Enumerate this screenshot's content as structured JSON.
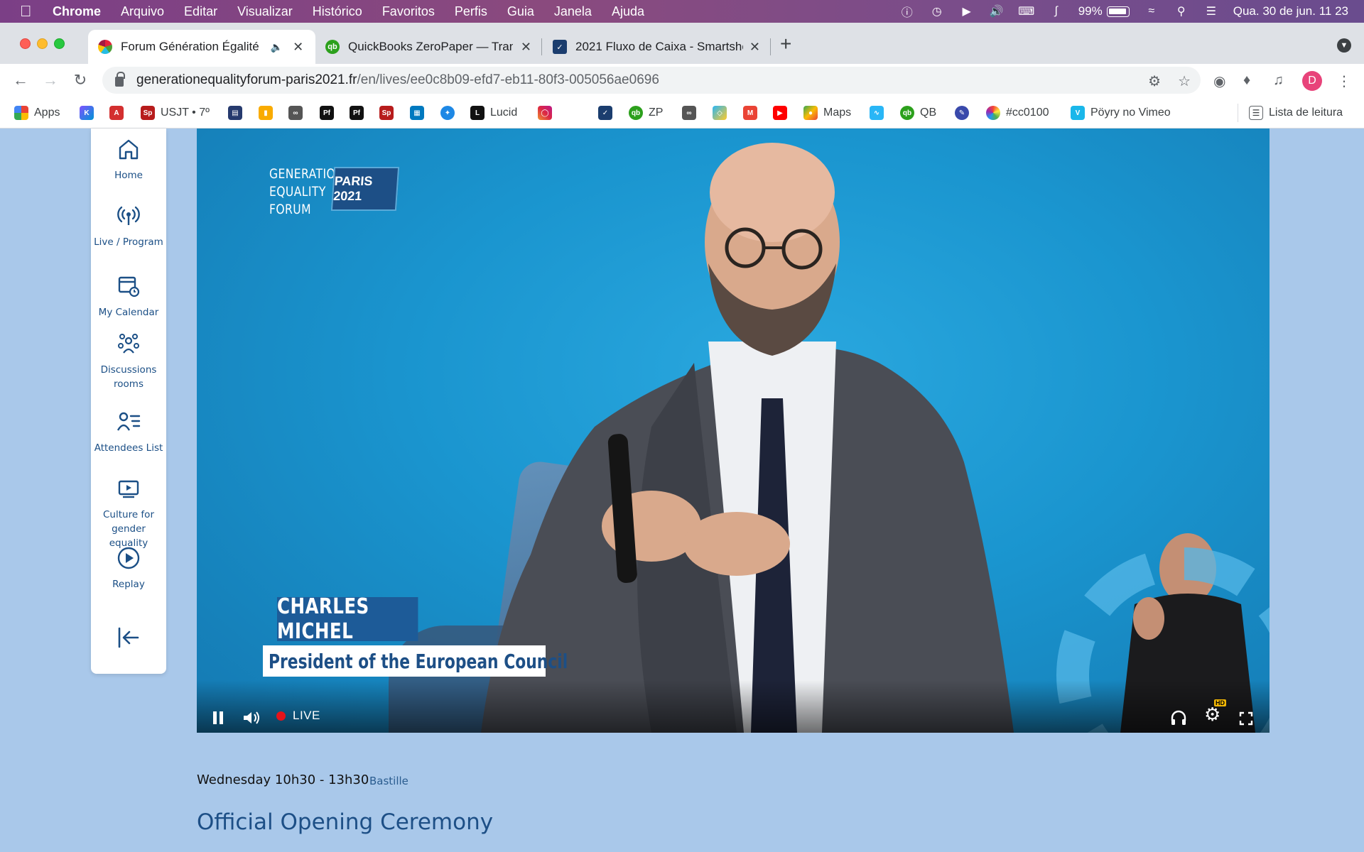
{
  "menubar": {
    "app": "Chrome",
    "items": [
      "Arquivo",
      "Editar",
      "Visualizar",
      "Histórico",
      "Favoritos",
      "Perfis",
      "Guia",
      "Janela",
      "Ajuda"
    ],
    "battery": "99%",
    "datetime": "Qua. 30 de jun.  11 23"
  },
  "tabs": [
    {
      "title": "Forum Génération Égalité",
      "favicon": "un-women-favicon",
      "active": true
    },
    {
      "title": "QuickBooks ZeroPaper — Trans",
      "favicon": "quickbooks-favicon",
      "active": false
    },
    {
      "title": "2021 Fluxo de Caixa - Smartshe",
      "favicon": "smartsheet-favicon",
      "active": false
    }
  ],
  "omnibox": {
    "domain": "generationequalityforum-paris2021.fr",
    "path": "/en/lives/ee0c8b09-efd7-eb11-80f3-005056ae0696"
  },
  "profile": {
    "initial": "D",
    "color": "#e8437a"
  },
  "bookmarks": [
    {
      "label": "Apps",
      "icon": "apps-grid-icon"
    },
    {
      "label": "",
      "icon": "kotlin-icon"
    },
    {
      "label": "",
      "icon": "pdf-icon"
    },
    {
      "label": "USJT • 7º",
      "icon": "sp-icon"
    },
    {
      "label": "",
      "icon": "book-icon"
    },
    {
      "label": "",
      "icon": "analytics-icon"
    },
    {
      "label": "",
      "icon": "infinity-icon"
    },
    {
      "label": "",
      "icon": "pf-icon"
    },
    {
      "label": "",
      "icon": "pf-icon"
    },
    {
      "label": "",
      "icon": "sp-icon"
    },
    {
      "label": "",
      "icon": "trello-icon"
    },
    {
      "label": "",
      "icon": "bug-icon"
    },
    {
      "label": "Lucid",
      "icon": "lucid-icon"
    },
    {
      "label": "",
      "icon": "instagram-icon"
    },
    {
      "label": "",
      "icon": "smartsheet-icon"
    },
    {
      "label": "ZP",
      "icon": "quickbooks-icon"
    },
    {
      "label": "",
      "icon": "infinity-icon"
    },
    {
      "label": "",
      "icon": "diamond-icon"
    },
    {
      "label": "",
      "icon": "gmail-icon"
    },
    {
      "label": "",
      "icon": "youtube-icon"
    },
    {
      "label": "Maps",
      "icon": "maps-icon"
    },
    {
      "label": "",
      "icon": "wave-icon"
    },
    {
      "label": "QB",
      "icon": "quickbooks-icon"
    },
    {
      "label": "",
      "icon": "pen-icon"
    },
    {
      "label": "#cc0100",
      "icon": "color-wheel-icon"
    },
    {
      "label": "Pöyry no Vimeo",
      "icon": "vimeo-icon"
    },
    {
      "label": "Lista de leitura",
      "icon": "reading-list-icon"
    }
  ],
  "sidebar": {
    "items": [
      {
        "label": "Home",
        "icon": "home-icon"
      },
      {
        "label": "Live / Program",
        "icon": "broadcast-icon"
      },
      {
        "label": "My Calendar",
        "icon": "calendar-clock-icon"
      },
      {
        "label": "Discussions rooms",
        "icon": "discussion-group-icon"
      },
      {
        "label": "Attendees List",
        "icon": "attendees-list-icon"
      },
      {
        "label": "Culture for gender equality",
        "icon": "video-play-icon"
      },
      {
        "label": "Replay",
        "icon": "replay-icon"
      },
      {
        "label": "",
        "icon": "logout-icon"
      }
    ]
  },
  "video": {
    "logo_lines": [
      "GENERATION",
      "EQUALITY",
      "FORUM"
    ],
    "logo_badge": "PARIS 2021",
    "speaker_name": "CHARLES MICHEL",
    "speaker_title": "President of the European Council",
    "live_label": "LIVE",
    "hd_badge": "HD",
    "state": "playing"
  },
  "session": {
    "time": "Wednesday 10h30 - 13h30",
    "room": "Bastille",
    "title": "Official Opening Ceremony"
  }
}
